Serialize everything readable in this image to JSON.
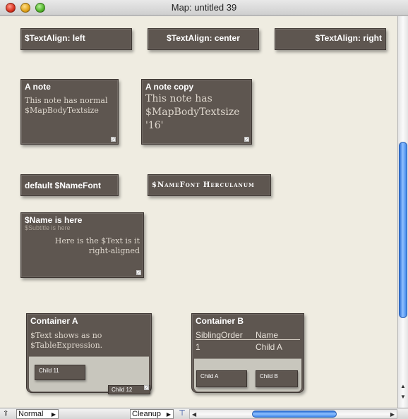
{
  "window": {
    "title": "Map: untitled 39"
  },
  "notes": {
    "align_left": "$TextAlign: left",
    "align_center": "$TextAlign: center",
    "align_right": "$TextAlign: right",
    "a_note": {
      "title": "A note",
      "body": "This note has normal $MapBodyTextsize"
    },
    "a_note_copy": {
      "title": "A note copy",
      "body": "This note has $MapBodyTextsize '16'"
    },
    "default_namefont": "default $NameFont",
    "herculanum": "$NameFont Herculanum",
    "name_here": {
      "title": "$Name is  here",
      "subtitle": "$Subtitle is here",
      "body": "Here is the $Text is it right-aligned"
    },
    "container_a": {
      "title": "Container A",
      "body": "$Text shows as no $TableExpression.",
      "child1": "Child 11",
      "child2": "Child 12"
    },
    "container_b": {
      "title": "Container B",
      "col1_header": "SiblingOrder",
      "col2_header": "Name",
      "row_col1": "1",
      "row_col2": "Child A",
      "child1": "Child A",
      "child2": "Child B"
    }
  },
  "bottombar": {
    "mode": "Normal",
    "cleanup": "Cleanup"
  }
}
